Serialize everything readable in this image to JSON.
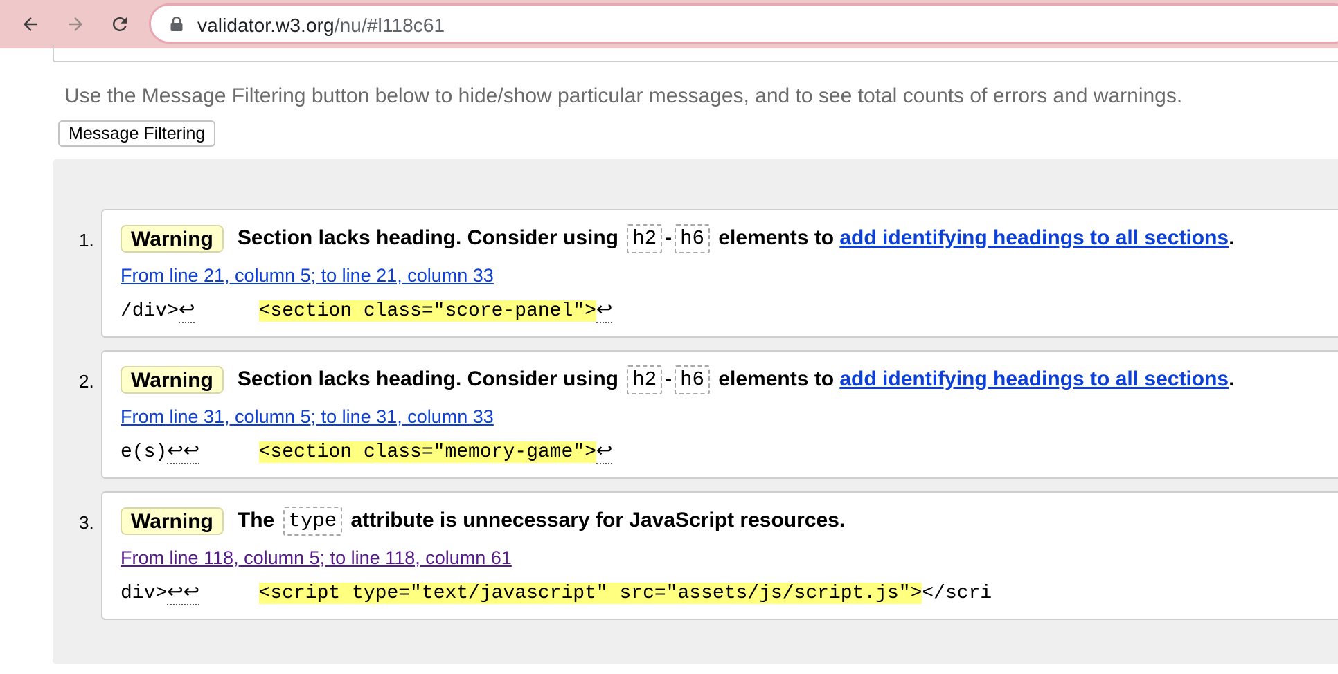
{
  "browser": {
    "back_label": "Back",
    "forward_label": "Forward",
    "reload_label": "Reload",
    "url_host": "validator.w3.org",
    "url_path": "/nu/#l118c61"
  },
  "page": {
    "intro": "Use the Message Filtering button below to hide/show particular messages, and to see total counts of errors and warnings.",
    "filter_button": "Message Filtering"
  },
  "messages": [
    {
      "number": "1.",
      "type": "Warning",
      "text_before": "Section lacks heading. Consider using",
      "code_a": "h2",
      "dash": "-",
      "code_b": "h6",
      "text_mid": "elements to",
      "link": "add identifying headings to all sections",
      "text_end": ".",
      "location": "From line 21, column 5; to line 21, column 33",
      "extract_before": "/div>",
      "extract_mark": "↩",
      "extract_highlight": "<section class=\"score-panel\">",
      "extract_after_mark": "↩"
    },
    {
      "number": "2.",
      "type": "Warning",
      "text_before": "Section lacks heading. Consider using",
      "code_a": "h2",
      "dash": "-",
      "code_b": "h6",
      "text_mid": "elements to",
      "link": "add identifying headings to all sections",
      "text_end": ".",
      "location": "From line 31, column 5; to line 31, column 33",
      "extract_before": "e(s)",
      "extract_mark": "↩↩",
      "extract_highlight": "<section class=\"memory-game\">",
      "extract_after_mark": "↩"
    },
    {
      "number": "3.",
      "type": "Warning",
      "text_before": "The",
      "code_a": "type",
      "text_mid": "attribute is unnecessary for JavaScript resources.",
      "location": "From line 118, column 5; to line 118, column 61",
      "extract_before": "div>",
      "extract_mark": "↩↩",
      "extract_highlight": "<script type=\"text/javascript\" src=\"assets/js/script.js\">",
      "extract_after": "</scri"
    }
  ]
}
